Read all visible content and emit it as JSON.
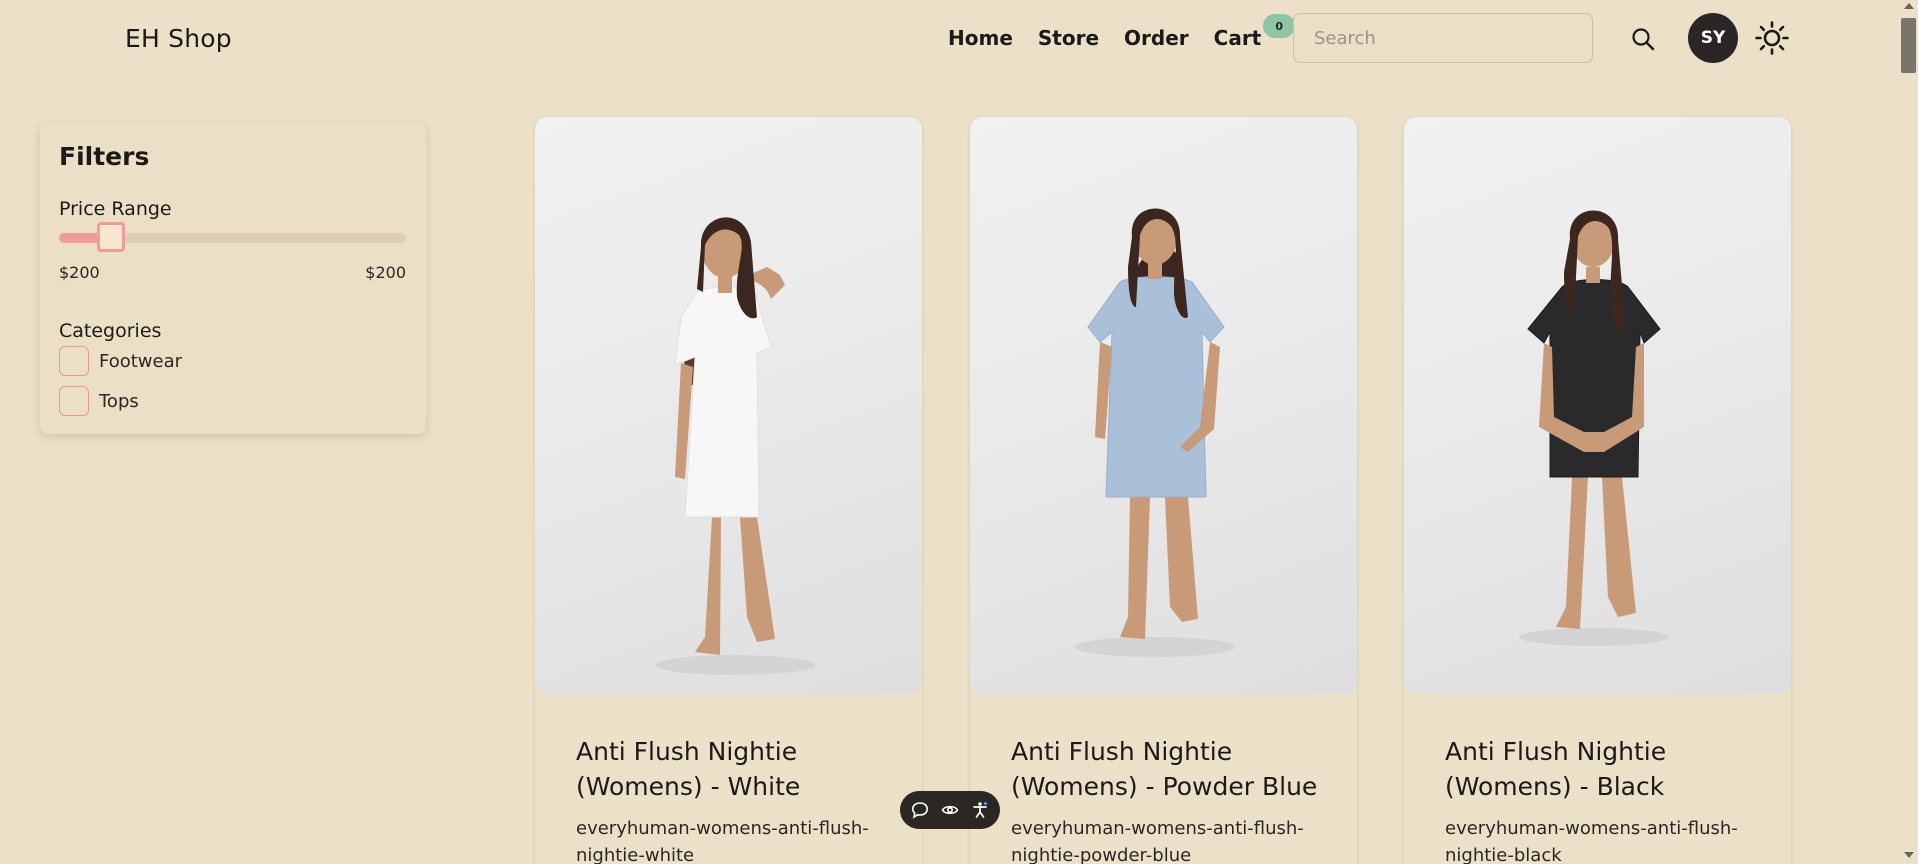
{
  "header": {
    "brand": "EH Shop",
    "nav": [
      "Home",
      "Store",
      "Order",
      "Cart"
    ],
    "cart_count": "0",
    "search_placeholder": "Search",
    "avatar_initials": "SY"
  },
  "filters": {
    "title": "Filters",
    "price_range_label": "Price Range",
    "price_min": "$200",
    "price_max": "$200",
    "slider_value_percent": 15,
    "categories_label": "Categories",
    "categories": [
      "Footwear",
      "Tops"
    ]
  },
  "products": [
    {
      "title": "Anti Flush Nightie (Womens) - White",
      "slug": "everyhuman-womens-anti-flush-nightie-white",
      "dress_color": "#f7f7f7"
    },
    {
      "title": "Anti Flush Nightie (Womens) - Powder Blue",
      "slug": "everyhuman-womens-anti-flush-nightie-powder-blue",
      "dress_color": "#a9c0d8"
    },
    {
      "title": "Anti Flush Nightie (Womens) - Black",
      "slug": "everyhuman-womens-anti-flush-nightie-black",
      "dress_color": "#2a2a2c"
    }
  ],
  "colors": {
    "background": "#ece1c8",
    "accent_pink": "#f29b9b",
    "badge_green": "#8fc4a4",
    "avatar_bg": "#2b2626"
  },
  "icons": {
    "search": "search-icon",
    "theme": "sun-icon",
    "toolbar": [
      "chat-icon",
      "eye-icon",
      "accessibility-icon"
    ]
  }
}
